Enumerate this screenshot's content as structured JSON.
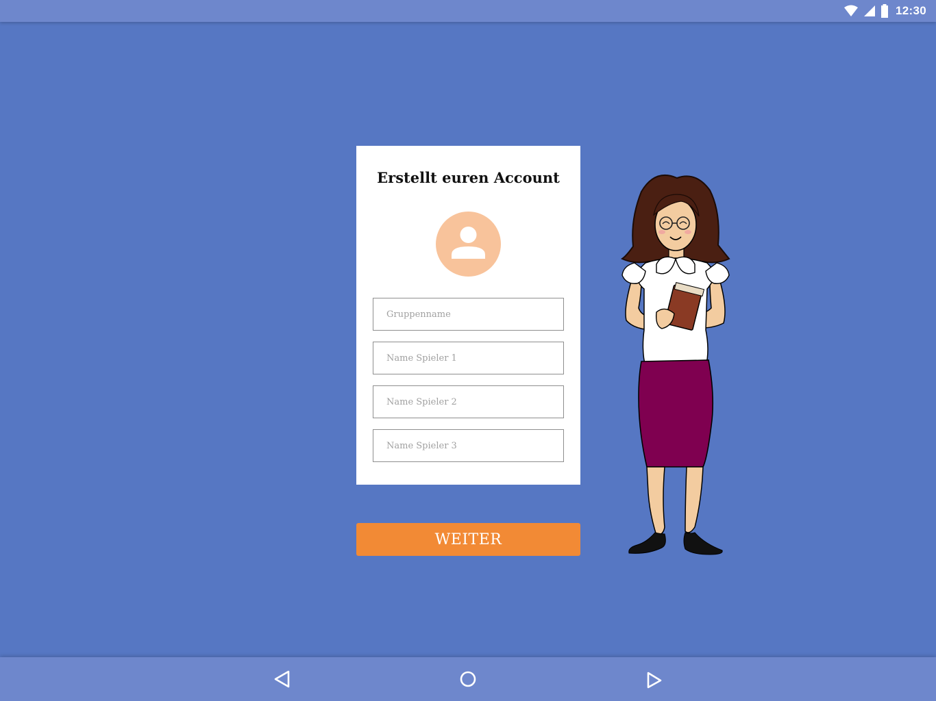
{
  "status_bar": {
    "time": "12:30",
    "icons": [
      "wifi-icon",
      "cell-signal-icon",
      "battery-icon"
    ]
  },
  "form": {
    "title": "Erstellt euren Account",
    "avatar_icon": "user-avatar-icon",
    "fields": [
      {
        "placeholder": "Gruppenname",
        "value": ""
      },
      {
        "placeholder": "Name Spieler 1",
        "value": ""
      },
      {
        "placeholder": "Name Spieler 2",
        "value": ""
      },
      {
        "placeholder": "Name Spieler 3",
        "value": ""
      }
    ],
    "submit_label": "WEITER"
  },
  "illustration": {
    "name": "teacher-character",
    "holds": "book"
  },
  "nav_bar": {
    "icons": [
      "back-icon",
      "home-icon",
      "forward-icon"
    ]
  },
  "colors": {
    "background": "#5677c3",
    "bars": "#6e87cc",
    "card": "#ffffff",
    "avatar": "#f8c39b",
    "button": "#f28a35",
    "skirt": "#7f0050",
    "hair": "#4a1f12"
  }
}
